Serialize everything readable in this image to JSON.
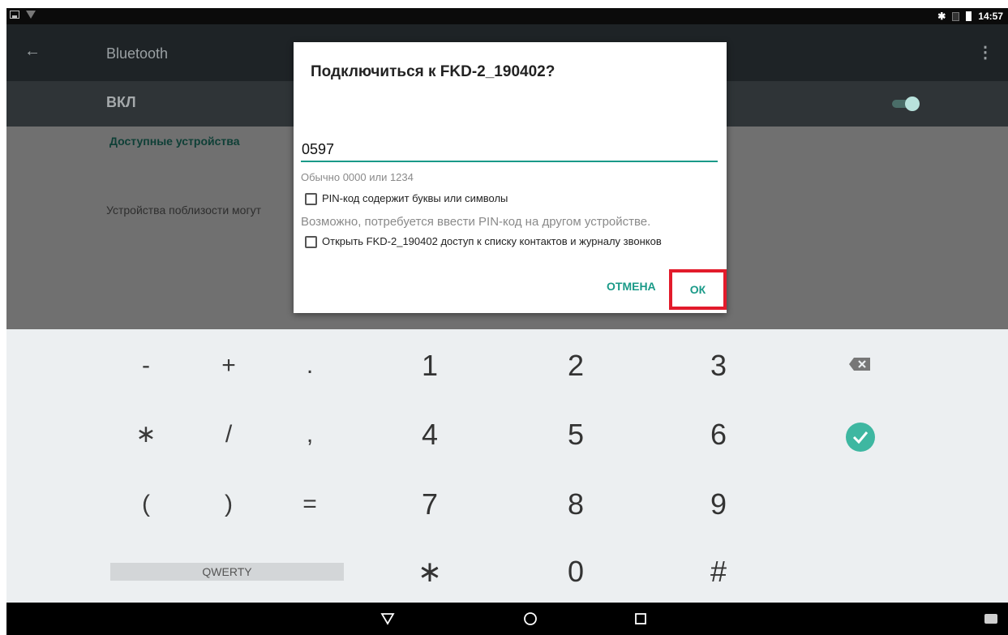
{
  "status_bar": {
    "time": "14:57"
  },
  "app_bar": {
    "title": "Bluetooth"
  },
  "toggle_row": {
    "label": "ВКЛ",
    "enabled": true
  },
  "list": {
    "section_header": "Доступные устройства",
    "nearby_text": "Устройства поблизости могут"
  },
  "dialog": {
    "title": "Подключиться к FKD-2_190402?",
    "pin_value": "0597",
    "hint": "Обычно 0000 или 1234",
    "checkbox_letters": "PIN-код содержит буквы или символы",
    "note": "Возможно, потребуется ввести PIN-код на другом устройстве.",
    "checkbox_contacts": "Открыть FKD-2_190402 доступ к списку контактов и журналу звонков",
    "cancel_label": "ОТМЕНА",
    "ok_label": "ОК"
  },
  "keyboard": {
    "symbols_row1": [
      "-",
      "+",
      "."
    ],
    "symbols_row2": [
      "∗",
      "/",
      ","
    ],
    "symbols_row3": [
      "(",
      ")",
      "="
    ],
    "digits": [
      "1",
      "2",
      "3",
      "4",
      "5",
      "6",
      "7",
      "8",
      "9",
      "∗",
      "0",
      "#"
    ],
    "layout_switch_label": "QWERTY"
  },
  "colors": {
    "accent": "#1a9a88",
    "highlight": "#e21b2b"
  }
}
